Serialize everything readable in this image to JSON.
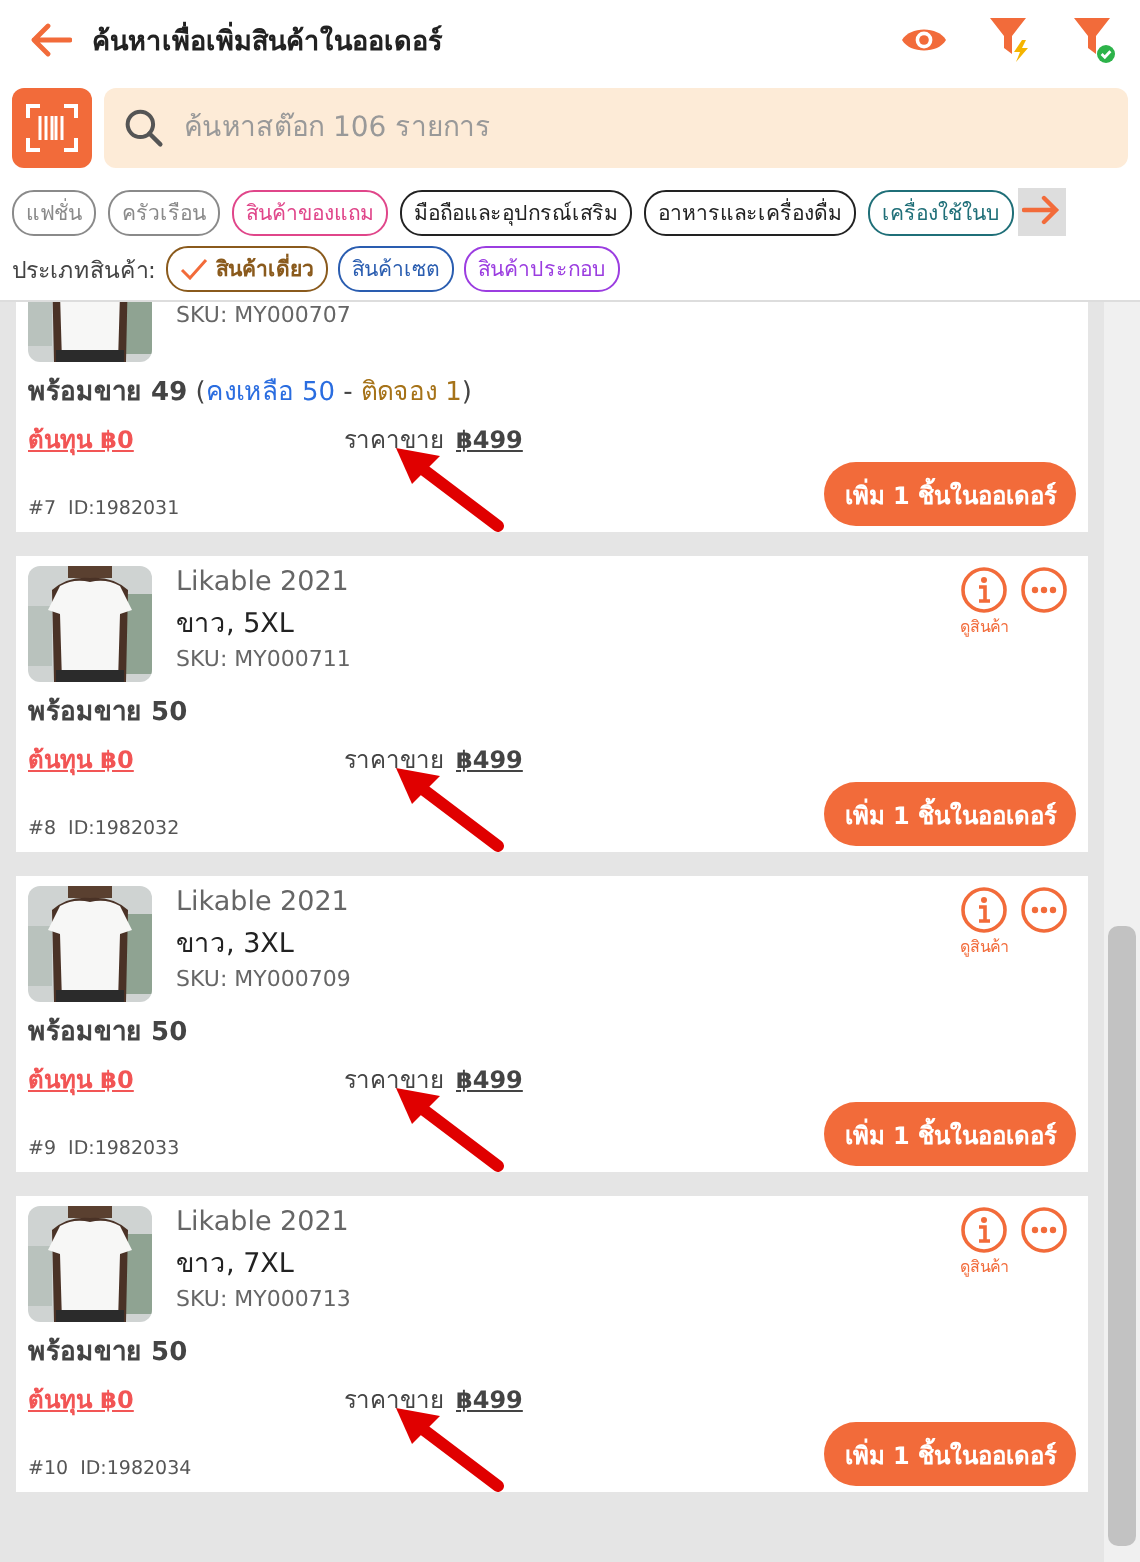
{
  "header": {
    "title": "ค้นหาเพื่อเพิ่มสินค้าในออเดอร์"
  },
  "search": {
    "placeholder": "ค้นหาสต๊อก 106 รายการ"
  },
  "categories": [
    {
      "label": "แฟชั่น",
      "color": "#8a8a8a"
    },
    {
      "label": "ครัวเรือน",
      "color": "#8a8a8a"
    },
    {
      "label": "สินค้าของแถม",
      "color": "#e0468a"
    },
    {
      "label": "มือถือและอุปกรณ์เสริม",
      "color": "#222222"
    },
    {
      "label": "อาหารและเครื่องดื่ม",
      "color": "#222222"
    },
    {
      "label": "เครื่องใช้ในบ",
      "color": "#1f6f78"
    }
  ],
  "type_filter": {
    "label": "ประเภทสินค้า:",
    "options": [
      {
        "label": "สินค้าเดี่ยว",
        "color": "#8a5a1c",
        "selected": true
      },
      {
        "label": "สินค้าเซต",
        "color": "#2a5db0",
        "selected": false
      },
      {
        "label": "สินค้าประกอบ",
        "color": "#9b3de0",
        "selected": false
      }
    ]
  },
  "products": [
    {
      "sku": "SKU: MY000707",
      "stock": [
        {
          "text": "พร้อมขาย 49",
          "kind": "ready"
        },
        {
          "text": " (",
          "kind": "plain"
        },
        {
          "text": "คงเหลือ 50",
          "kind": "remaining"
        },
        {
          "text": " - ",
          "kind": "plain"
        },
        {
          "text": "ติดจอง 1",
          "kind": "reserved"
        },
        {
          "text": ")",
          "kind": "plain"
        }
      ],
      "cost": "ต้นทุน ฿0",
      "price_label": "ราคาขาย",
      "price": "฿499",
      "index": "#7",
      "id": "ID:1982031",
      "button": "เพิ่ม 1 ชิ้นในออเดอร์"
    },
    {
      "name": "Likable 2021",
      "variant": "ขาว, 5XL",
      "sku": "SKU: MY000711",
      "view_label": "ดูสินค้า",
      "stock": [
        {
          "text": "พร้อมขาย 50",
          "kind": "ready"
        }
      ],
      "cost": "ต้นทุน ฿0",
      "price_label": "ราคาขาย",
      "price": "฿499",
      "index": "#8",
      "id": "ID:1982032",
      "button": "เพิ่ม 1 ชิ้นในออเดอร์"
    },
    {
      "name": "Likable 2021",
      "variant": "ขาว, 3XL",
      "sku": "SKU: MY000709",
      "view_label": "ดูสินค้า",
      "stock": [
        {
          "text": "พร้อมขาย 50",
          "kind": "ready"
        }
      ],
      "cost": "ต้นทุน ฿0",
      "price_label": "ราคาขาย",
      "price": "฿499",
      "index": "#9",
      "id": "ID:1982033",
      "button": "เพิ่ม 1 ชิ้นในออเดอร์"
    },
    {
      "name": "Likable 2021",
      "variant": "ขาว, 7XL",
      "sku": "SKU: MY000713",
      "view_label": "ดูสินค้า",
      "stock": [
        {
          "text": "พร้อมขาย 50",
          "kind": "ready"
        }
      ],
      "cost": "ต้นทุน ฿0",
      "price_label": "ราคาขาย",
      "price": "฿499",
      "index": "#10",
      "id": "ID:1982034",
      "button": "เพิ่ม 1 ชิ้นในออเดอร์"
    }
  ]
}
